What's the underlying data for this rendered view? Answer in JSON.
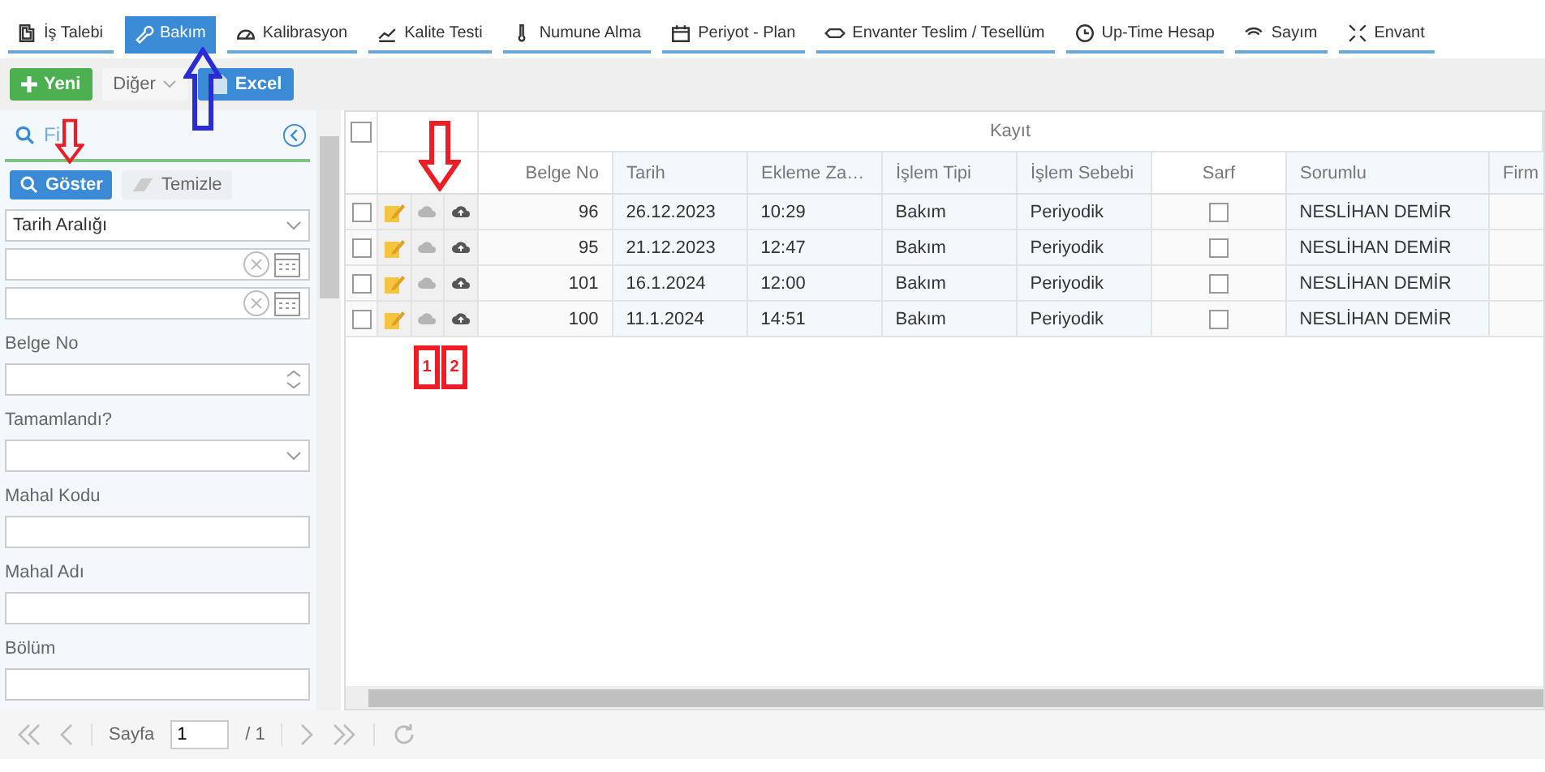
{
  "nav": [
    {
      "label": "İş Talebi",
      "selected": false
    },
    {
      "label": "Bakım",
      "selected": true
    },
    {
      "label": "Kalibrasyon",
      "selected": false
    },
    {
      "label": "Kalite Testi",
      "selected": false
    },
    {
      "label": "Numune Alma",
      "selected": false
    },
    {
      "label": "Periyot - Plan",
      "selected": false
    },
    {
      "label": "Envanter Teslim / Tesellüm",
      "selected": false
    },
    {
      "label": "Up-Time Hesap",
      "selected": false
    },
    {
      "label": "Sayım",
      "selected": false
    },
    {
      "label": "Envant",
      "selected": false
    }
  ],
  "toolbar": [
    {
      "label": "Yeni",
      "kind": "add"
    },
    {
      "label": "Diğer",
      "kind": "menu"
    },
    {
      "label": "Excel",
      "kind": "excel"
    }
  ],
  "filter": {
    "title": "Fi",
    "buttons": [
      {
        "label": "Göster",
        "kind": "show"
      },
      {
        "label": "Temizle",
        "kind": "clear"
      }
    ],
    "fields": [
      {
        "kind": "select",
        "value": "Tarih Aralığı"
      },
      {
        "kind": "date"
      },
      {
        "kind": "date"
      },
      {
        "kind": "number",
        "label": "Belge No"
      },
      {
        "kind": "select",
        "label": "Tamamlandı?"
      },
      {
        "kind": "text",
        "label": "Mahal Kodu"
      },
      {
        "kind": "text",
        "label": "Mahal Adı"
      },
      {
        "kind": "text",
        "label": "Bölüm"
      }
    ]
  },
  "table": {
    "group": "Kayıt",
    "all_checked": false,
    "columns": [
      {
        "label": "Belge No"
      },
      {
        "label": "Tarih"
      },
      {
        "label": "Ekleme Za…"
      },
      {
        "label": "İşlem Tipi"
      },
      {
        "label": "İşlem Sebebi"
      },
      {
        "label": "Sarf"
      },
      {
        "label": "Sorumlu"
      },
      {
        "label": "Firm"
      }
    ],
    "rows": [
      {
        "checked": false,
        "belge": "96",
        "tarih": "26.12.2023",
        "saat": "10:29",
        "tip": "Bakım",
        "sebep": "Periyodik",
        "sarf": false,
        "sorumlu": "NESLİHAN DEMİR"
      },
      {
        "checked": false,
        "belge": "95",
        "tarih": "21.12.2023",
        "saat": "12:47",
        "tip": "Bakım",
        "sebep": "Periyodik",
        "sarf": false,
        "sorumlu": "NESLİHAN DEMİR"
      },
      {
        "checked": false,
        "belge": "101",
        "tarih": "16.1.2024",
        "saat": "12:00",
        "tip": "Bakım",
        "sebep": "Periyodik",
        "sarf": false,
        "sorumlu": "NESLİHAN DEMİR"
      },
      {
        "checked": false,
        "belge": "100",
        "tarih": "11.1.2024",
        "saat": "14:51",
        "tip": "Bakım",
        "sebep": "Periyodik",
        "sarf": false,
        "sorumlu": "NESLİHAN DEMİR"
      }
    ]
  },
  "pager": {
    "label": "Sayfa",
    "page": "1",
    "total": "/ 1"
  },
  "annotations": [
    {
      "kind": "arrow-down",
      "color": "#ee1c25"
    },
    {
      "kind": "arrow-down",
      "color": "#ee1c25"
    },
    {
      "kind": "arrow-up",
      "color": "#2b2bd6"
    },
    {
      "kind": "tag",
      "label": "1",
      "color": "#ee1c25"
    },
    {
      "kind": "tag",
      "label": "2",
      "color": "#ee1c25"
    }
  ]
}
